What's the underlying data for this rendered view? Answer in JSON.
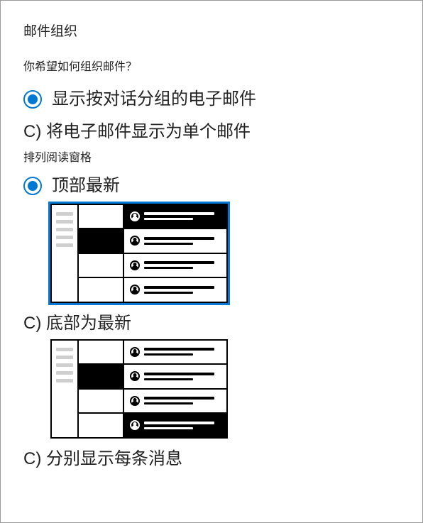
{
  "section_title": "邮件组织",
  "question": "你希望如何组织邮件？",
  "organize": {
    "option_grouped": "显示按对话分组的电子邮件",
    "option_single": "C) 将电子邮件显示为单个邮件"
  },
  "reading_pane_label": "排列阅读窗格",
  "reading_pane": {
    "option_top": "顶部最新",
    "option_bottom": "C) 底部为最新",
    "option_separate": "C) 分别显示每条消息"
  }
}
